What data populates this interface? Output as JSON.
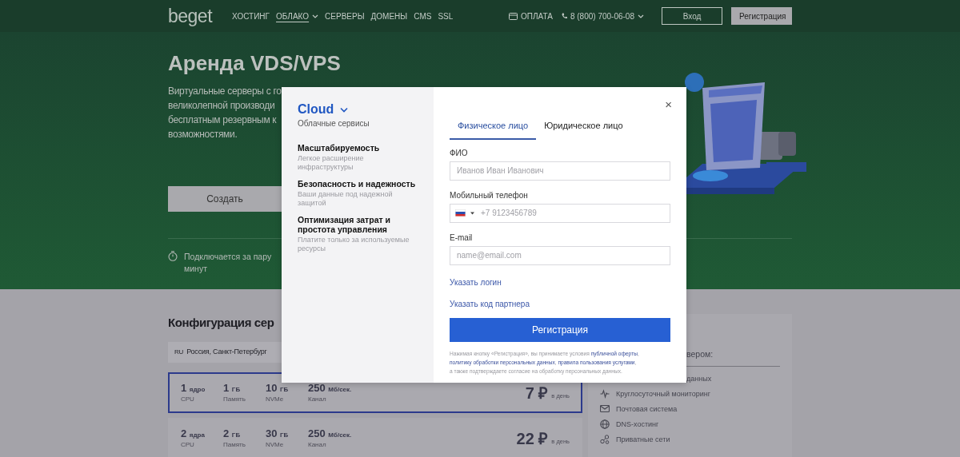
{
  "header": {
    "logo": "beget",
    "nav": [
      {
        "label": "ХОСТИНГ",
        "selected": false,
        "dropdown": false
      },
      {
        "label": "ОБЛАКО",
        "selected": true,
        "dropdown": true
      },
      {
        "label": "СЕРВЕРЫ",
        "selected": false,
        "dropdown": false
      },
      {
        "label": "ДОМЕНЫ",
        "selected": false,
        "dropdown": false
      },
      {
        "label": "CMS",
        "selected": false,
        "dropdown": false
      },
      {
        "label": "SSL",
        "selected": false,
        "dropdown": false
      }
    ],
    "payment": "ОПЛАТА",
    "phone": "8 (800) 700-06-08",
    "login": "Вход",
    "register": "Регистрация"
  },
  "hero": {
    "title": "Аренда VDS/VPS",
    "lines": [
      "Виртуальные серверы с го",
      "великолепной производи",
      "бесплатным резервным к",
      "возможностями."
    ],
    "create_button": "Создать",
    "feature": "Подключается за пару минут"
  },
  "config": {
    "title": "Конфигурация сер",
    "location_code": "RU",
    "location": "Россия, Санкт-Петербург",
    "plans": [
      {
        "selected": true,
        "specs": [
          {
            "value": "1",
            "unit": "ядро",
            "label": "CPU"
          },
          {
            "value": "1",
            "unit": "ГБ",
            "label": "Память"
          },
          {
            "value": "10",
            "unit": "ГБ",
            "label": "NVMe"
          },
          {
            "value": "250",
            "unit": "Мб/сек.",
            "label": "Канал"
          }
        ],
        "price": "7 ₽",
        "period": "в день"
      },
      {
        "selected": false,
        "specs": [
          {
            "value": "2",
            "unit": "ядра",
            "label": "CPU"
          },
          {
            "value": "2",
            "unit": "ГБ",
            "label": "Память"
          },
          {
            "value": "30",
            "unit": "ГБ",
            "label": "NVMe"
          },
          {
            "value": "250",
            "unit": "Мб/сек.",
            "label": "Канал"
          }
        ],
        "price": "22 ₽",
        "period": "в день"
      }
    ]
  },
  "side_panel": {
    "heading": "вером:",
    "items": [
      {
        "kind": "fragment",
        "text": "данных"
      },
      {
        "kind": "feature",
        "text": "Круглосуточный мониторинг"
      },
      {
        "kind": "feature",
        "text": "Почтовая система"
      },
      {
        "kind": "feature",
        "text": "DNS-хостинг"
      },
      {
        "kind": "feature",
        "text": "Приватные сети"
      }
    ]
  },
  "modal": {
    "brand": "Cloud",
    "subtitle": "Облачные сервисы",
    "benefits": [
      {
        "title": "Масштабируемость",
        "text": "Легкое расширение инфраструктуры"
      },
      {
        "title": "Безопасность и надежность",
        "text": "Ваши данные под надежной защитой"
      },
      {
        "title": "Оптимизация затрат и простота управления",
        "text": "Платите только за используемые ресурсы"
      }
    ],
    "close": "×",
    "tabs": [
      {
        "label": "Физическое лицо",
        "selected": true
      },
      {
        "label": "Юридическое лицо",
        "selected": false
      }
    ],
    "fields": [
      {
        "kind": "text",
        "label": "ФИО",
        "placeholder": "Иванов Иван Иванович"
      },
      {
        "kind": "phone",
        "label": "Мобильный телефон",
        "placeholder": "+7 9123456789"
      },
      {
        "kind": "text",
        "label": "E-mail",
        "placeholder": "name@email.com"
      }
    ],
    "links": [
      "Указать логин",
      "Указать код партнера"
    ],
    "submit": "Регистрация",
    "legal": [
      [
        {
          "text": "Нажимая кнопку «Регистрация», вы принимаете условия "
        },
        {
          "text": "публичной оферты",
          "link": true
        },
        {
          "text": ","
        }
      ],
      [
        {
          "text": "политику обработки персональных данных",
          "link": true
        },
        {
          "text": ", "
        },
        {
          "text": "правила пользования услугами",
          "link": true
        },
        {
          "text": ","
        }
      ],
      [
        {
          "text": "а также подтверждаете согласие на обработку персональных данных."
        }
      ]
    ]
  }
}
